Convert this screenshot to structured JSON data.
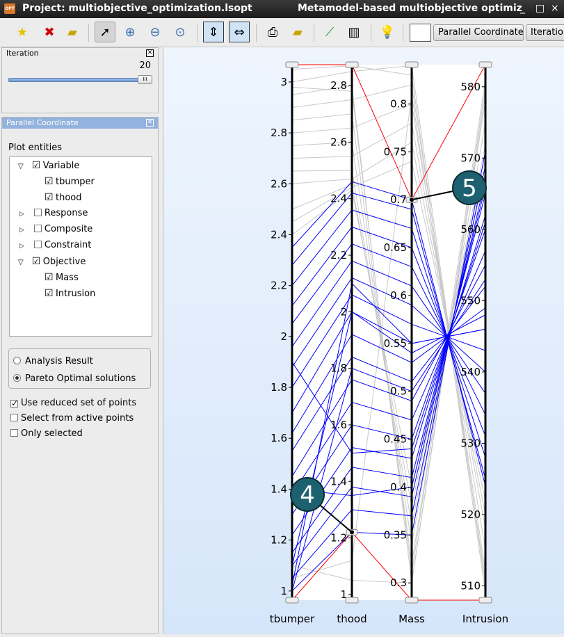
{
  "window": {
    "title": "Project: multiobjective_optimization.lsopt",
    "subtitle": "Metamodel-based multiobjective optimiz",
    "app_icon": "OPT",
    "minimize": "_",
    "maximize": "□",
    "close": "×"
  },
  "toolbar": {
    "icons": [
      "new-plot-icon",
      "delete-plot-icon",
      "open-folder-icon",
      "pointer-icon",
      "zoom-in-icon",
      "zoom-out-icon",
      "zoom-reset-icon",
      "fit-vertical-icon",
      "fit-horizontal-icon",
      "print-icon",
      "save-image-icon",
      "link-icon",
      "table-icon",
      "tip-bulb-icon"
    ],
    "tab1": "Parallel Coordinate",
    "tab2": "Iteration"
  },
  "iteration_panel": {
    "title": "Iteration",
    "value": "20",
    "slider_fraction": 1.0
  },
  "pc_panel": {
    "title": "Parallel Coordinate",
    "plot_entities_label": "Plot entities",
    "tree": [
      {
        "label": "Variable",
        "checked": true,
        "expanded": true
      },
      {
        "label": "tbumper",
        "checked": true
      },
      {
        "label": "thood",
        "checked": true
      },
      {
        "label": "Response",
        "checked": false
      },
      {
        "label": "Composite",
        "checked": false
      },
      {
        "label": "Constraint",
        "checked": false
      },
      {
        "label": "Objective",
        "checked": true,
        "expanded": true
      },
      {
        "label": "Mass",
        "checked": true
      },
      {
        "label": "Intrusion",
        "checked": true
      }
    ],
    "radio_analysis": "Analysis Result",
    "radio_pareto": "Pareto Optimal solutions",
    "radio_selected": "Pareto Optimal solutions",
    "opt_reduced": "Use reduced set of points",
    "opt_active": "Select from active points",
    "opt_only": "Only selected",
    "reduced_checked": true,
    "active_checked": false,
    "only_checked": false
  },
  "chart_data": {
    "type": "parallel-coordinates",
    "axes": [
      {
        "name": "tbumper",
        "range": [
          0.964,
          3.068
        ],
        "ticks": [
          1,
          1.2,
          1.4,
          1.6,
          1.8,
          2,
          2.2,
          2.4,
          2.6,
          2.8,
          3
        ]
      },
      {
        "name": "thood",
        "range": [
          0.98,
          2.874
        ],
        "ticks": [
          1,
          1.2,
          1.4,
          1.6,
          1.8,
          2,
          2.2,
          2.4,
          2.6,
          2.8
        ]
      },
      {
        "name": "Mass",
        "range": [
          0.282,
          0.841
        ],
        "ticks": [
          0.3,
          0.35,
          0.4,
          0.45,
          0.5,
          0.55,
          0.6,
          0.65,
          0.7,
          0.75,
          0.8
        ]
      },
      {
        "name": "Intrusion",
        "range": [
          508,
          583.1
        ],
        "ticks": [
          510,
          520,
          530,
          540,
          550,
          560,
          570,
          580
        ]
      }
    ],
    "colors": {
      "pareto": "#0000ff",
      "other": "#c8c8c8",
      "filter": "#ff0000"
    },
    "pareto_lines": [
      [
        1.0,
        1.22,
        0.35,
        571
      ],
      [
        1.05,
        1.3,
        0.37,
        569
      ],
      [
        1.1,
        1.38,
        0.39,
        567
      ],
      [
        1.15,
        1.45,
        0.41,
        565
      ],
      [
        1.22,
        1.52,
        0.43,
        562
      ],
      [
        1.3,
        1.6,
        0.45,
        560
      ],
      [
        1.38,
        1.68,
        0.47,
        557
      ],
      [
        1.45,
        1.76,
        0.49,
        555
      ],
      [
        1.55,
        1.84,
        0.51,
        552
      ],
      [
        1.62,
        1.92,
        0.53,
        549
      ],
      [
        1.7,
        2.0,
        0.55,
        546
      ],
      [
        1.8,
        2.06,
        0.57,
        543
      ],
      [
        1.88,
        2.12,
        0.59,
        540
      ],
      [
        1.96,
        2.18,
        0.61,
        537
      ],
      [
        2.05,
        2.24,
        0.63,
        534
      ],
      [
        2.12,
        2.3,
        0.65,
        531
      ],
      [
        2.2,
        2.36,
        0.67,
        528
      ],
      [
        2.28,
        2.42,
        0.69,
        525
      ],
      [
        2.35,
        2.46,
        0.7,
        524
      ],
      [
        1.02,
        2.1,
        0.55,
        546
      ],
      [
        1.0,
        1.8,
        0.5,
        553
      ],
      [
        1.1,
        2.0,
        0.54,
        548
      ],
      [
        1.4,
        1.35,
        0.4,
        566
      ],
      [
        1.9,
        1.5,
        0.44,
        561
      ]
    ],
    "other_lines": [
      [
        3.0,
        2.85,
        0.84,
        510
      ],
      [
        2.95,
        2.8,
        0.3,
        580
      ],
      [
        2.9,
        2.75,
        0.82,
        512
      ],
      [
        2.85,
        2.7,
        0.32,
        578
      ],
      [
        2.8,
        2.65,
        0.8,
        515
      ],
      [
        2.75,
        2.6,
        0.34,
        575
      ],
      [
        2.7,
        2.55,
        0.78,
        518
      ],
      [
        2.65,
        2.5,
        0.36,
        572
      ],
      [
        2.6,
        2.47,
        0.76,
        520
      ],
      [
        2.5,
        2.45,
        0.38,
        570
      ],
      [
        2.45,
        2.44,
        0.74,
        522
      ],
      [
        2.4,
        2.43,
        0.4,
        568
      ],
      [
        3.05,
        2.87,
        0.83,
        509
      ],
      [
        2.98,
        2.78,
        0.31,
        581
      ],
      [
        1.1,
        1.05,
        0.3,
        579
      ],
      [
        1.05,
        1.12,
        0.81,
        511
      ]
    ],
    "filter_lines": [
      [
        3.068,
        2.874,
        0.7,
        583.1
      ],
      [
        0.964,
        1.22,
        0.282,
        508
      ]
    ],
    "annotations": [
      {
        "label": "4",
        "axis": "thood",
        "value": 1.22
      },
      {
        "label": "5",
        "axis": "Mass",
        "value": 0.7
      }
    ]
  }
}
